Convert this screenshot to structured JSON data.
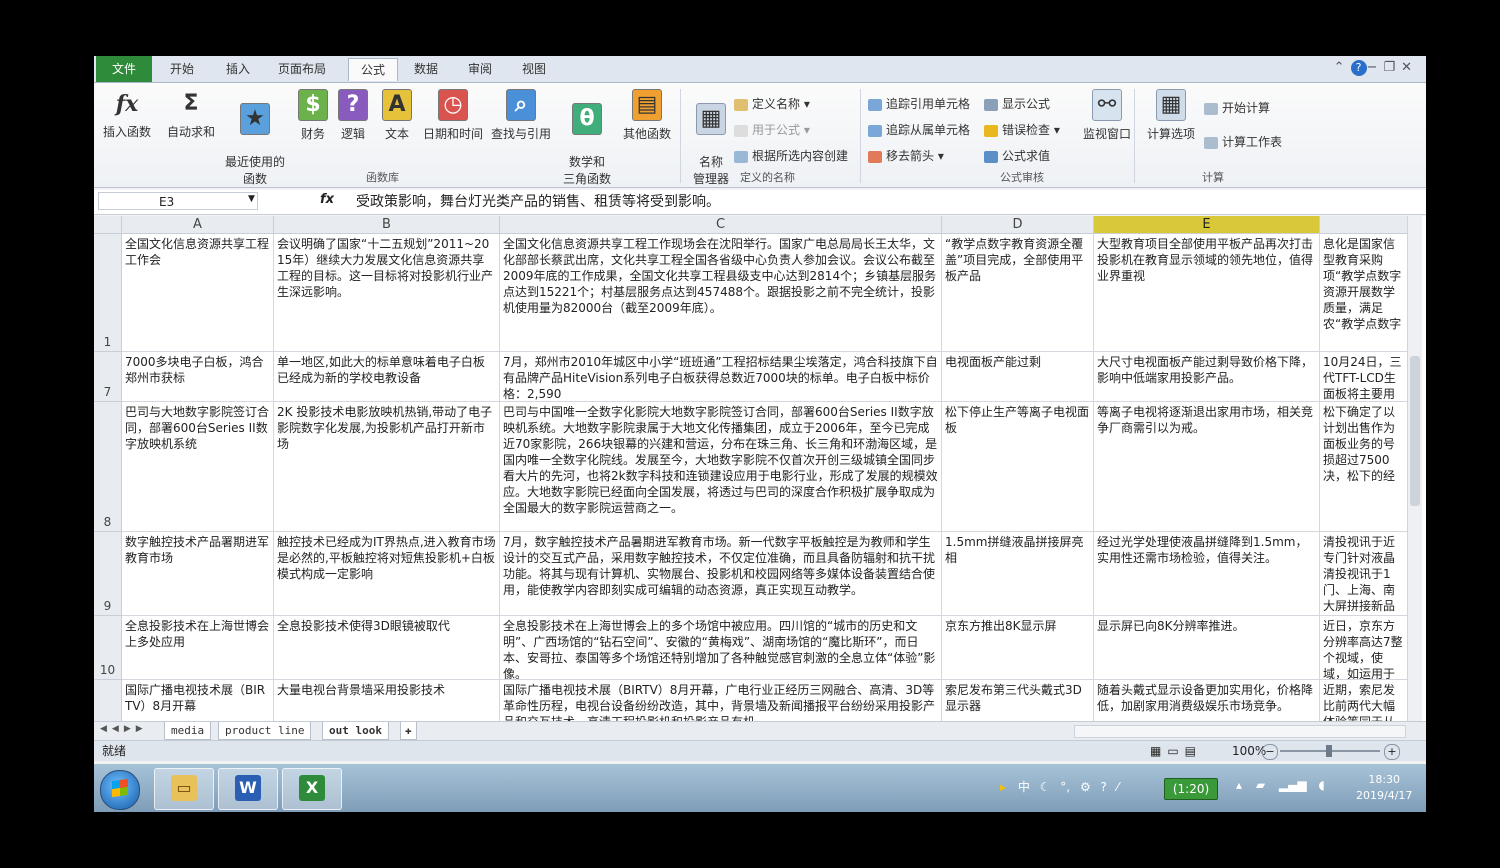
{
  "ribbon_tabs": [
    "文件",
    "开始",
    "插入",
    "页面布局",
    "公式",
    "数据",
    "审阅",
    "视图"
  ],
  "ribbon": {
    "insert_function": "插入函数",
    "autosum": "自动求和",
    "recent": "最近使用的\n函数",
    "financial": "财务",
    "logical": "逻辑",
    "text": "文本",
    "datetime": "日期和时间",
    "lookup": "查找与引用",
    "math": "数学和\n三角函数",
    "more": "其他函数",
    "group_library": "函数库",
    "name_manager": "名称\n管理器",
    "define_name": "定义名称",
    "use_in_formula": "用于公式",
    "create_from_sel": "根据所选内容创建",
    "group_names": "定义的名称",
    "trace_precedents": "追踪引用单元格",
    "trace_dependents": "追踪从属单元格",
    "remove_arrows": "移去箭头",
    "show_formulas": "显示公式",
    "error_check": "错误检查",
    "evaluate": "公式求值",
    "watch": "监视窗口",
    "group_audit": "公式审核",
    "calc_options": "计算选项",
    "calc_now": "开始计算",
    "calc_sheet": "计算工作表",
    "group_calc": "计算"
  },
  "formula_bar": {
    "name_box": "E3",
    "fx": "fx",
    "content": "受政策影响，舞台灯光类产品的销售、租赁等将受到影响。"
  },
  "columns": [
    "A",
    "B",
    "C",
    "D",
    "E",
    ""
  ],
  "rows": [
    {
      "num": "1",
      "cells": [
        "全国文化信息资源共享工程工作会",
        "会议明确了国家“十二五规划”2011~2015年）继续大力发展文化信息资源共享工程的目标。这一目标将对投影机行业产生深远影响。",
        "全国文化信息资源共享工程工作现场会在沈阳举行。国家广电总局局长王太华，文化部部长蔡武出席，文化共享工程全国各省级中心负责人参加会议。会议公布截至2009年底的工作成果，全国文化共享工程县级支中心达到2814个；乡镇基层服务点达到15221个；村基层服务点达到457488个。跟据投影之前不完全统计，投影机使用量为82000台（截至2009年底）。",
        "“教学点数字教育资源全覆盖”项目完成，全部使用平板产品",
        "大型教育项目全部使用平板产品再次打击投影机在教育显示领域的领先地位，值得业界重视",
        "息化是国家信型教育采购项“教学点数字资源开展数学质量，满足农“教学点数字"
      ]
    },
    {
      "num": "7",
      "cells": [
        "7000多块电子白板，鸿合郑州市获标",
        "单一地区,如此大的标单意味着电子白板已经成为新的学校电教设备",
        "7月，郑州市2010年城区中小学“班班通”工程招标结果尘埃落定，鸿合科技旗下自有品牌产品HiteVision系列电子白板获得总数近7000块的标单。电子白板中标价格：2,590",
        "电视面板产能过剩",
        "大尺寸电视面板产能过剩导致价格下降，影响中低端家用投影产品。",
        "10月24日，三代TFT-LCD生面板将主要用"
      ]
    },
    {
      "num": "8",
      "cells": [
        "巴司与大地数字影院签订合同，部署600台Series II数字放映机系统",
        "2K 投影技术电影放映机热销,带动了电子影院数字化发展,为投影机产品打开新市场",
        "巴司与中国唯一全数字化影院大地数字影院签订合同，部署600台Series II数字放映机系统。大地数字影院隶属于大地文化传播集团，成立于2006年，至今已完成近70家影院，266块银幕的兴建和营运，分布在珠三角、长三角和环渤海区域，是国内唯一全数字化院线。发展至今，大地数字影院不仅首次开创三级城镇全国同步看大片的先河，也将2k数字科技和连锁建设应用于电影行业，形成了发展的规模效应。大地数字影院已经面向全国发展，将透过与巴司的深度合作积极扩展争取成为全国最大的数字影院运营商之一。",
        "松下停止生产等离子电视面板",
        "等离子电视将逐渐退出家用市场，相关竞争厂商需引以为戒。",
        "松下确定了以计划出售作为面板业务的号损超过7500决，松下的经"
      ]
    },
    {
      "num": "9",
      "cells": [
        "数字触控技术产品署期进军教育市场",
        "触控技术已经成为IT界热点,进入教育市场是必然的,平板触控将对短焦投影机+白板模式构成一定影响",
        "7月，数字触控技术产品暑期进军教育市场。新一代数字平板触控是为教师和学生设计的交互式产品，采用数字触控技术，不仅定位准确，而且具备防辐射和抗干扰功能。将其与现有计算机、实物展台、投影机和校园网络等多媒体设备装置结合使用，能使教学内容即刻实成可编辑的动态资源，真正实现互动教学。",
        "1.5mm拼缝液晶拼接屏亮相",
        "经过光学处理使液晶拼缝降到1.5mm，实用性还需市场检验，值得关注。",
        "清投视讯于近专门针对液晶清投视讯于1门、上海、南大屏拼接新品"
      ]
    },
    {
      "num": "10",
      "cells": [
        "全息投影技术在上海世博会上多处应用",
        "全息投影技术使得3D眼镜被取代",
        "全息投影技术在上海世博会上的多个场馆中被应用。四川馆的“城市的历史和文明”、广西场馆的“钻石空间”、安徽的“黄梅戏”、湖南场馆的“魔比斯环”，而日本、安哥拉、泰国等多个场馆还特别增加了各种触觉感官刺激的全息立体“体验”影像。",
        "京东方推出8K显示屏",
        "显示屏已向8K分辨率推进。",
        "近日，京东方分辨率高达7整个视域，使域，如运用于"
      ]
    },
    {
      "num": "",
      "cells": [
        "国际广播电视技术展（BIRTV）8月开幕",
        "大量电视台背景墙采用投影技术",
        "国际广播电视技术展（BIRTV）8月开幕，广电行业正经历三网融合、高清、3D等革命性历程，电视台设备纷纷改造，其中，背景墙及新闻播报平台纷纷采用投影产品和交互技术。高清工程投影机和投影产品有机",
        "索尼发布第三代头戴式3D显示器",
        "随着头戴式显示设备更加实用化，价格降低，加剧家用消费级娱乐市场竞争。",
        "近期，索尼发比前两代大幅体验等同于从"
      ]
    }
  ],
  "sheet_tabs": [
    "media",
    "product line",
    "out look"
  ],
  "status": {
    "ready": "就绪",
    "zoom": "100%"
  },
  "taskbar": {
    "word": "W",
    "excel": "X",
    "ime": "中",
    "battery": "(1:20)",
    "time": "18:30",
    "date": "2019/4/17"
  }
}
